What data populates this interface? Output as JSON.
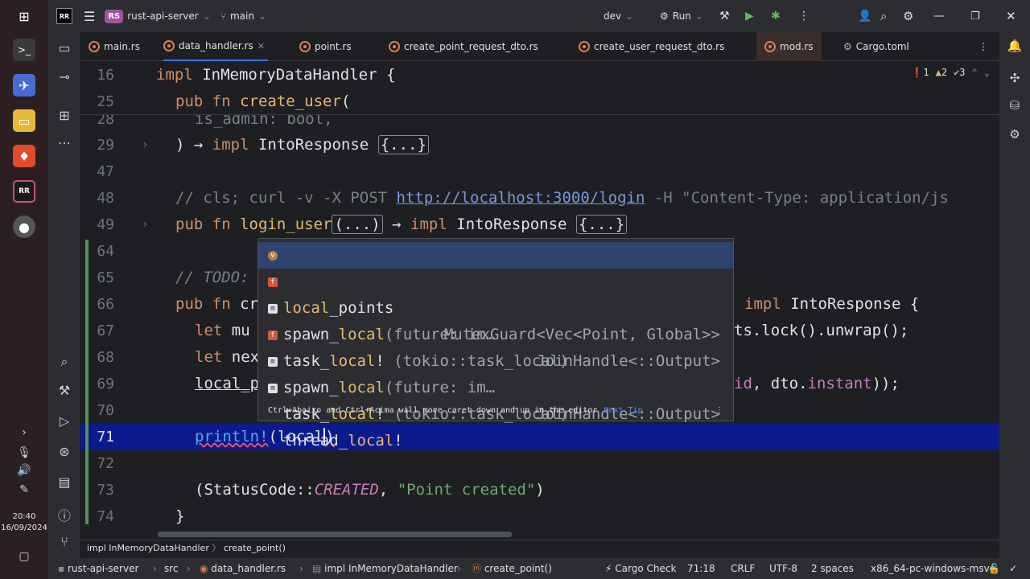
{
  "taskbar": {
    "clock_time": "20:40",
    "clock_date": "16/09/2024"
  },
  "titlebar": {
    "project_badge": "RS",
    "project_name": "rust-api-server",
    "branch": "main",
    "run_config": "dev",
    "run_label": "Run"
  },
  "tabs": [
    {
      "label": "main.rs"
    },
    {
      "label": "data_handler.rs"
    },
    {
      "label": "point.rs"
    },
    {
      "label": "create_point_request_dto.rs"
    },
    {
      "label": "create_user_request_dto.rs"
    },
    {
      "label": "mod.rs"
    },
    {
      "label": "Cargo.toml"
    }
  ],
  "inspections": {
    "errors": "1",
    "warnings": "2",
    "weak": "3"
  },
  "editor": {
    "lines": [
      {
        "num": "16",
        "parts": [
          "impl",
          " InMemoryDataHandler {"
        ]
      },
      {
        "num": "25",
        "parts": [
          "pub fn",
          " ",
          "create_user",
          "("
        ]
      },
      {
        "num": "28",
        "parts": [
          "is_admin: bool,"
        ]
      },
      {
        "num": "29",
        "parts": [
          ") → ",
          "impl",
          " IntoResponse ",
          "{...}"
        ]
      },
      {
        "num": "47",
        "parts": []
      },
      {
        "num": "48",
        "parts": [
          "// cls; curl -v -X POST ",
          "http://localhost:3000/login",
          " -H \"Content-Type: application/js"
        ]
      },
      {
        "num": "49",
        "parts": [
          "pub fn",
          " ",
          "login_user",
          "(...)",
          " → ",
          "impl",
          " IntoResponse ",
          "{...}"
        ]
      },
      {
        "num": "64",
        "parts": []
      },
      {
        "num": "65",
        "parts": [
          "// TODO: "
        ]
      },
      {
        "num": "66",
        "parts": [
          "pub fn",
          " cr",
          "impl",
          " IntoResponse {"
        ]
      },
      {
        "num": "67",
        "parts": [
          "let",
          " mu",
          "ts.lock().unwrap();"
        ]
      },
      {
        "num": "68",
        "parts": [
          "let",
          " nex"
        ]
      },
      {
        "num": "69",
        "parts": [
          "local_p",
          "id",
          ", dto.",
          "instant",
          "));"
        ]
      },
      {
        "num": "70",
        "parts": []
      },
      {
        "num": "71",
        "parts": [
          "println!",
          "(local",
          ")"
        ]
      },
      {
        "num": "72",
        "parts": []
      },
      {
        "num": "73",
        "parts": [
          "(StatusCode::",
          "CREATED",
          ", ",
          "\"Point created\"",
          ")"
        ]
      },
      {
        "num": "74",
        "parts": [
          "}"
        ]
      }
    ]
  },
  "completion": {
    "items": [
      {
        "icon": "v",
        "prefix": "",
        "match": "local",
        "suffix": "_points",
        "detail": "",
        "type": "MutexGuard<Vec<Point, Global>>"
      },
      {
        "icon": "f",
        "prefix": "spawn_",
        "match": "local",
        "suffix": "",
        "detail": "(future: im…",
        "type": "JoinHandle<::Output>"
      },
      {
        "icon": "m",
        "prefix": "task_",
        "match": "local",
        "suffix": "!",
        "detail": " (tokio::task_local)",
        "type": ""
      },
      {
        "icon": "f",
        "prefix": "spawn_",
        "match": "local",
        "suffix": "",
        "detail": "(future: im…",
        "type": "JoinHandle<::Output>"
      },
      {
        "icon": "m",
        "prefix": "task_",
        "match": "local",
        "suffix": "!",
        "detail": " (tokio::task_local)",
        "type": ""
      },
      {
        "icon": "m",
        "prefix": "thread_",
        "match": "local",
        "suffix": "!",
        "detail": "",
        "type": ""
      }
    ],
    "footer_text": "Ctrl+Abaixo and Ctrl+Acima will move caret down and up in the editor",
    "footer_link": "Next Tip"
  },
  "breadcrumb": {
    "a": "impl InMemoryDataHandler",
    "b": "create_point()"
  },
  "status": {
    "project": "rust-api-server",
    "src": "src",
    "file": "data_handler.rs",
    "impl": "impl InMemoryDataHandler",
    "fn": "create_point()",
    "cargo_check": "Cargo Check",
    "position": "71:18",
    "line_sep": "CRLF",
    "encoding": "UTF-8",
    "indent": "2 spaces",
    "toolchain": "x86_64-pc-windows-msvc"
  },
  "colors": {
    "accent": "#3574f0",
    "current_line": "#0b1a8c",
    "rust": "#e07b53"
  }
}
